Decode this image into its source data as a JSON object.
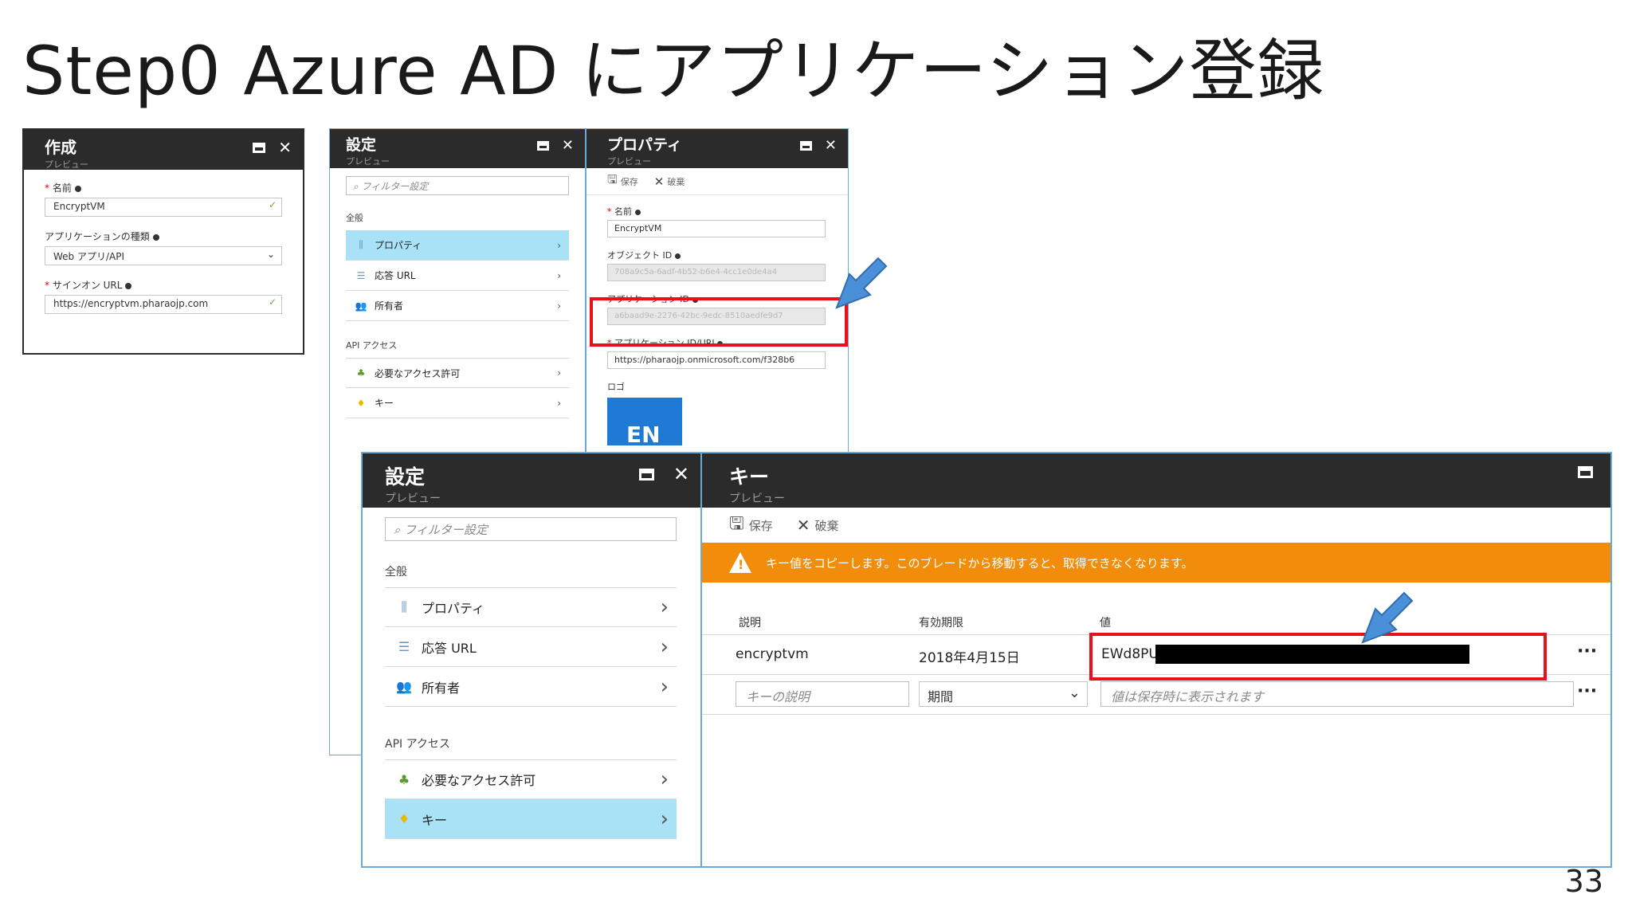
{
  "slide": {
    "title": "Step0  Azure AD にアプリケーション登録",
    "page_number": "33"
  },
  "colors": {
    "header": "#2b2b2b",
    "selected": "#a9e2f7",
    "warning": "#f28c0b",
    "highlight_box": "#e8101a",
    "arrow": "#4a90d9"
  },
  "create_blade": {
    "title": "作成",
    "subtitle": "プレビュー",
    "name_label": "名前",
    "name_value": "EncryptVM",
    "app_type_label": "アプリケーションの種類",
    "app_type_value": "Web アプリ/API",
    "signon_label": "サインオン URL",
    "signon_value": "https://encryptvm.pharaojp.com"
  },
  "settings_blade_small": {
    "title": "設定",
    "subtitle": "プレビュー",
    "search_placeholder": "フィルター設定",
    "section_general": "全般",
    "items": [
      "プロパティ",
      "応答 URL",
      "所有者"
    ],
    "section_api": "API アクセス",
    "api_items": [
      "必要なアクセス許可",
      "キー"
    ]
  },
  "properties_blade": {
    "title": "プロパティ",
    "subtitle": "プレビュー",
    "save": "保存",
    "discard": "破棄",
    "name_label": "名前",
    "name_value": "EncryptVM",
    "object_id_label": "オブジェクト ID",
    "object_id_value": "708a9c5a-6adf-4b52-b6e4-4cc1e0de4a4",
    "app_id_label": "アプリケーション ID",
    "app_id_value": "a6baad9e-2276-42bc-9edc-8510aedfe9d7",
    "app_uri_label": "アプリケーション ID/URI",
    "app_uri_value": "https://pharaojp.onmicrosoft.com/f328b6",
    "logo_label": "ロゴ",
    "logo_text": "EN"
  },
  "settings_blade_large": {
    "title": "設定",
    "subtitle": "プレビュー",
    "search_placeholder": "フィルター設定",
    "section_general": "全般",
    "items": [
      "プロパティ",
      "応答 URL",
      "所有者"
    ],
    "section_api": "API アクセス",
    "api_items": [
      "必要なアクセス許可",
      "キー"
    ]
  },
  "keys_blade": {
    "title": "キー",
    "subtitle": "プレビュー",
    "save": "保存",
    "discard": "破棄",
    "warning": "キー値をコピーします。このブレードから移動すると、取得できなくなります。",
    "col_desc": "説明",
    "col_expiry": "有効期限",
    "col_value": "値",
    "row_desc": "encryptvm",
    "row_expiry": "2018年4月15日",
    "row_value": "EWd8PU",
    "new_desc_placeholder": "キーの説明",
    "new_expiry": "期間",
    "new_value_placeholder": "値は保存時に表示されます",
    "more": "···"
  }
}
